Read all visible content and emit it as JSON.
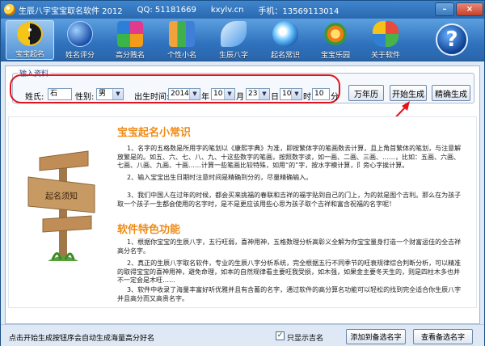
{
  "window": {
    "title": "生辰八字宝宝取名软件 2012",
    "qq": "QQ: 51181669",
    "site": "kxylv.cn",
    "phone": "手机：13569113014",
    "min_label": "–",
    "close_label": "×"
  },
  "toolbar": {
    "items": [
      {
        "label": "宝宝起名",
        "icon": "yin-yang-icon"
      },
      {
        "label": "姓名评分",
        "icon": "globe-icon"
      },
      {
        "label": "高分贱名",
        "icon": "cubes-icon"
      },
      {
        "label": "个性小名",
        "icon": "users-icon"
      },
      {
        "label": "生辰八字",
        "icon": "wing-icon"
      },
      {
        "label": "起名常识",
        "icon": "crystal-icon"
      },
      {
        "label": "宝宝乐园",
        "icon": "flower-icon"
      },
      {
        "label": "关于软件",
        "icon": "butterfly-icon"
      },
      {
        "label": "",
        "icon": "help-icon"
      }
    ]
  },
  "input": {
    "legend": "输入资料",
    "surname_label": "姓氏:",
    "surname_value": "石",
    "gender_label": "性别:",
    "gender_value": "男",
    "time_label": "出生时间:",
    "year": "2014",
    "year_unit": "年",
    "month": "10",
    "month_unit": "月",
    "day": "23",
    "day_unit": "日",
    "hour": "10",
    "hour_unit": "时",
    "minute": "10",
    "minute_unit": "分",
    "calendar_button": "万年历",
    "start_button": "开始生成",
    "precise_button": "精确生成"
  },
  "content": {
    "sign_text": "起名须知",
    "heading1": "宝宝起名小常识",
    "p1": "1、名字的五格数是所用字的笔划以《康熙字典》为准，即按繁体字的笔画数去计算，且上角首繁体的笔划，与注意解放繁是的。如五、六、七、八、九、十这些数字的笔画，按照数字读，如一画、二画、三画、……，比如：五画、六画、七画、八画、九画、十画……计算一些笔画比较特殊，如用“的”字，按水字模计算，阝旁心字挨计算。",
    "p2": "2、输入宝宝出生日期时注意时间是精确到分的，尽量精确输入。",
    "p3": "3、我们中国人在过年的时候，都会买来挑福的春联和吉祥的福字贴到自己的门上，为的就是图个吉利。那么在为孩子取一个孩子一生都会使用的名字时，是不是更应该用些心思为孩子取个吉祥和富含祝福的名字呢！",
    "heading2": "软件特色功能",
    "p4": "1、根据你宝宝的生辰八字，五行旺弱，喜神用神，五格数理分析高彰义全解为你宝宝量身打造一个财富运佳的全吉祥高分名字。",
    "p5": "2、真正的生辰八字取名软件，专业的生辰八字分析系统，完全根据五行不同季节的旺衰规律综合判断分析，可以精准的取得宝宝的喜神用神，避免命理，如本的自然规律看主要旺我受损，如木强，如果金主要冬天生的，则是四柱木多也并不一定会是木旺……",
    "p6": "3、软件中收录了海量丰富好听优雅并且有含蓄的名字，通过软件的高分算名功能可以轻松的找到完全适合你生辰八字并且高分而又高贵名字。"
  },
  "status": {
    "hint": "点击开始生成按钮序会自动生成海量高分好名",
    "checkbox_label": "只显示吉名",
    "checkbox_mark": "✓",
    "add_button": "添加到备选名字",
    "view_button": "查看备选名字"
  }
}
